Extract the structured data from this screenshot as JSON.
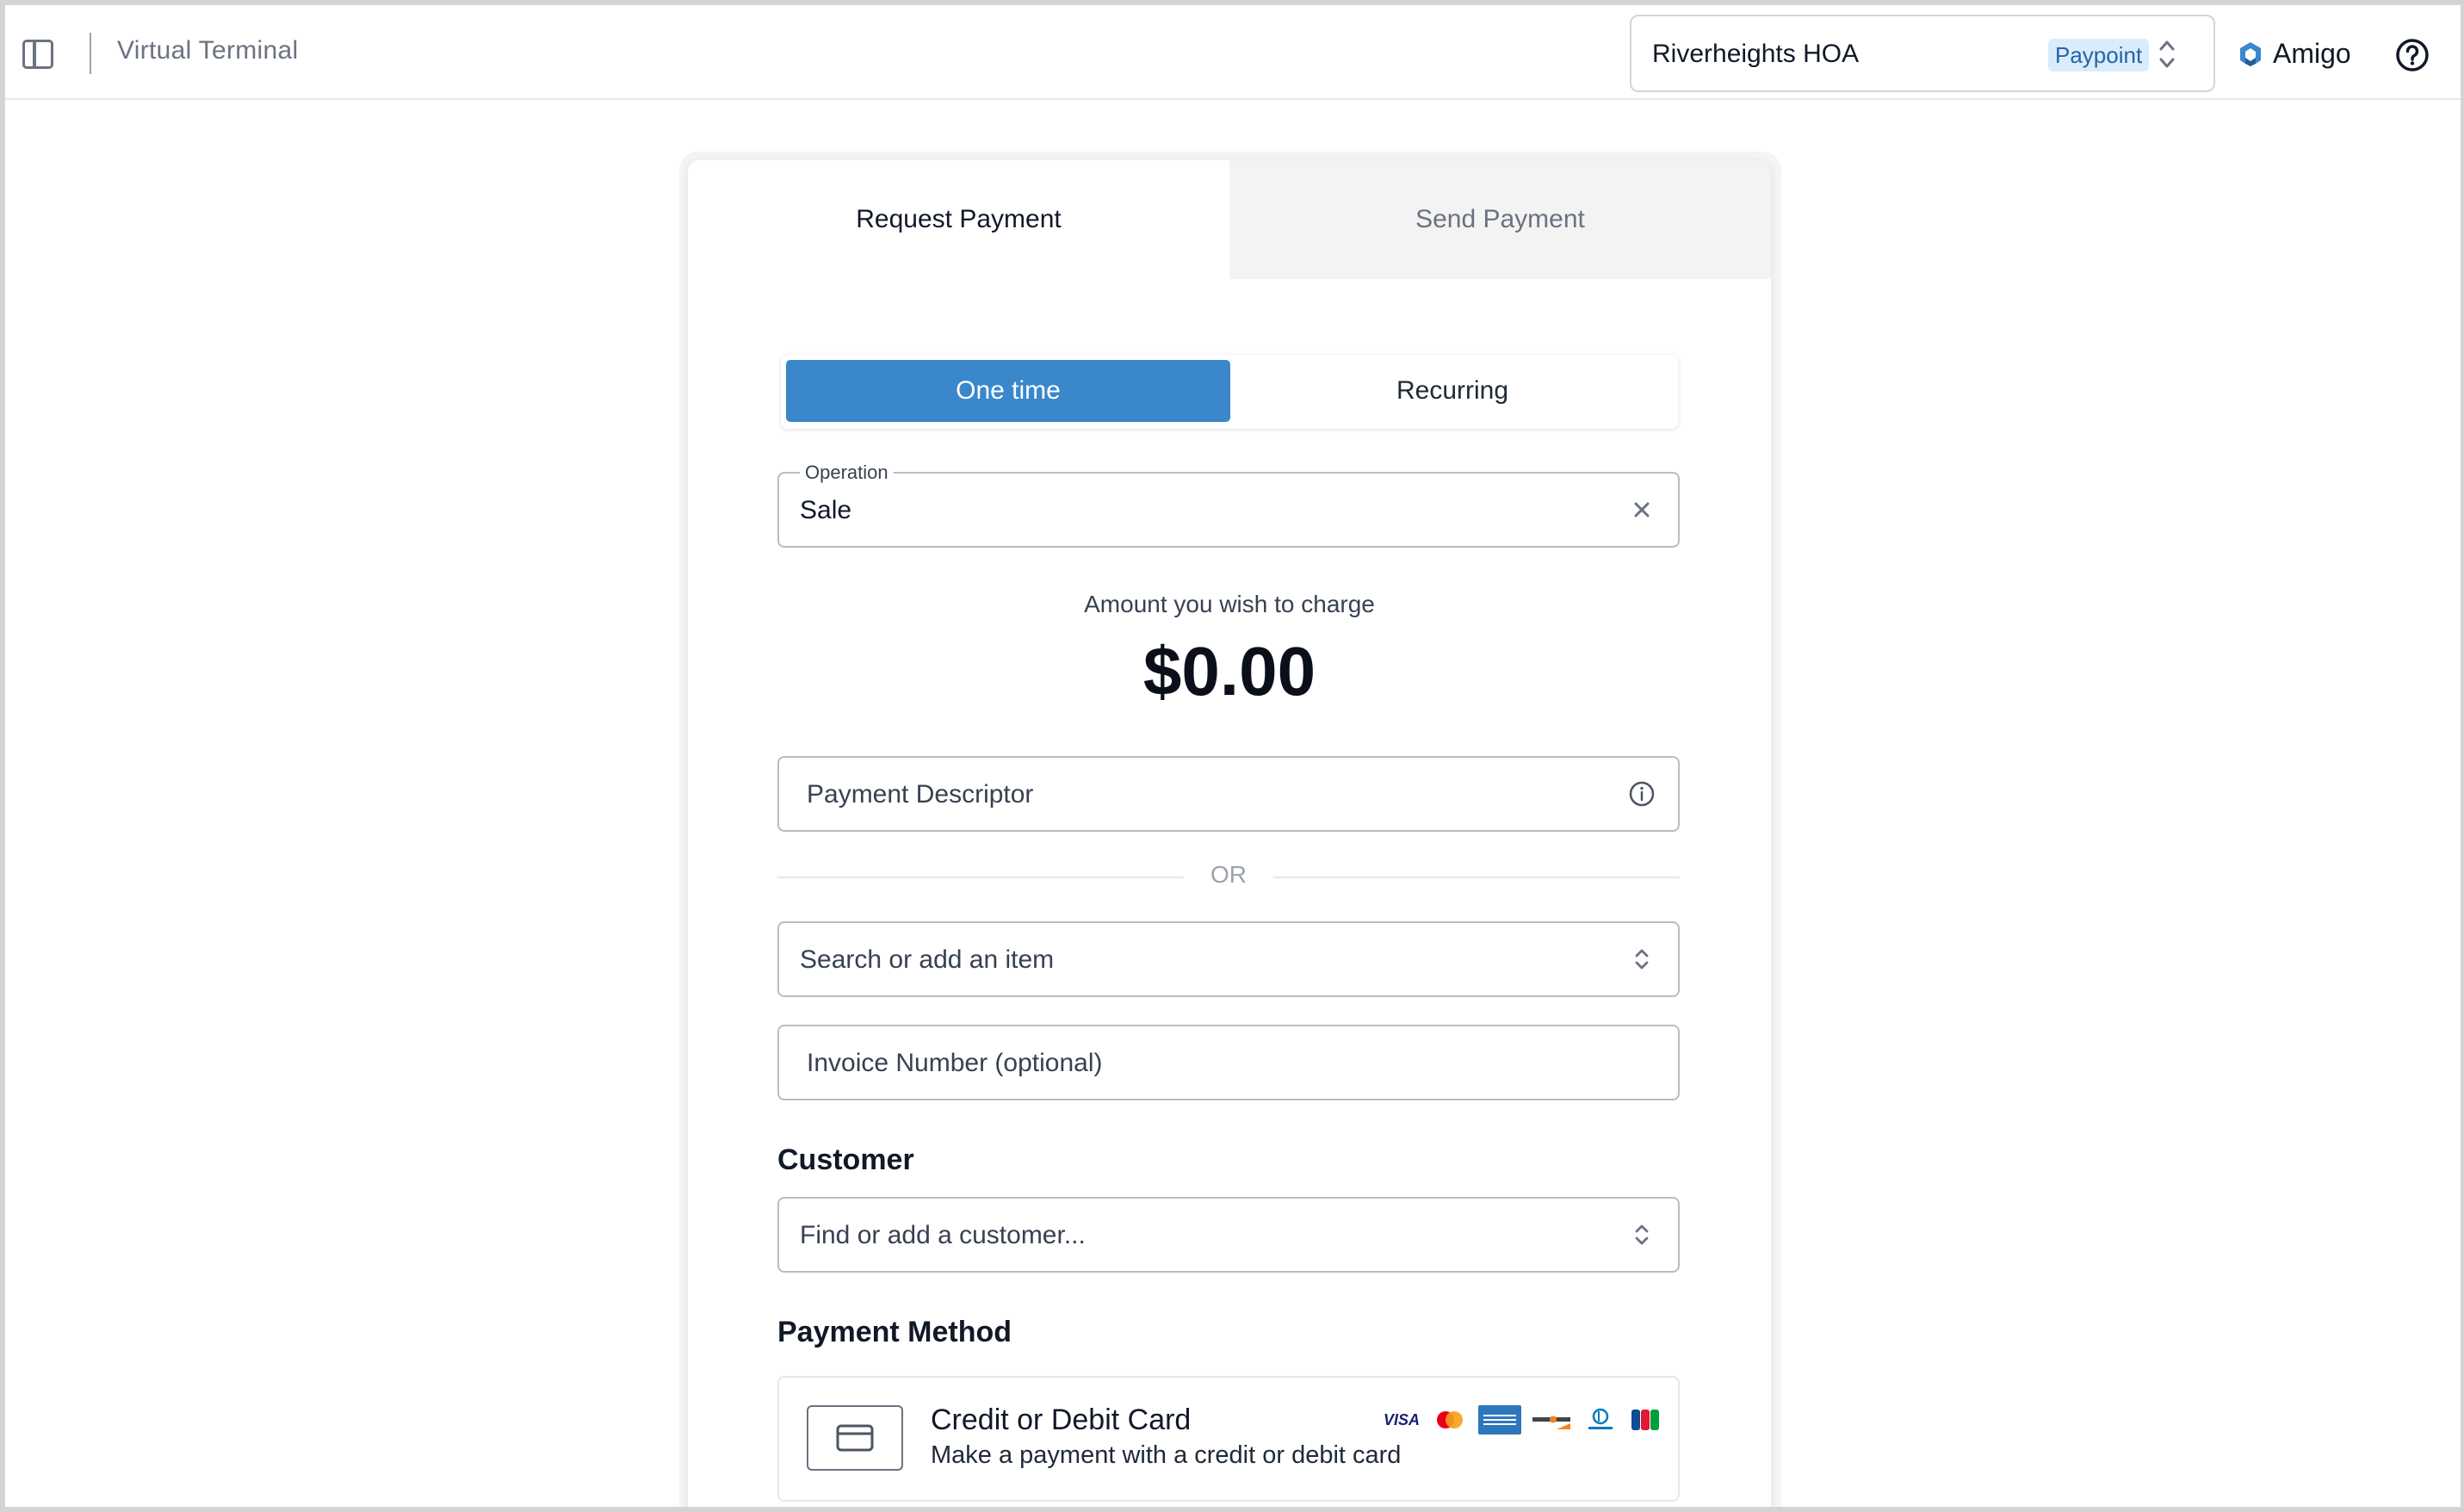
{
  "header": {
    "page_title": "Virtual Terminal",
    "org": {
      "name": "Riverheights HOA",
      "badge": "Paypoint"
    },
    "brand_name": "Amigo"
  },
  "tabs": [
    {
      "label": "Request Payment",
      "active": true
    },
    {
      "label": "Send Payment",
      "active": false
    }
  ],
  "frequency": {
    "options": [
      "One time",
      "Recurring"
    ],
    "selected": "One time"
  },
  "operation": {
    "label": "Operation",
    "value": "Sale"
  },
  "amount": {
    "label": "Amount you wish to charge",
    "value": "$0.00"
  },
  "payment_descriptor": {
    "placeholder": "Payment Descriptor"
  },
  "divider_text": "OR",
  "item_search": {
    "placeholder": "Search or add an item"
  },
  "invoice": {
    "placeholder": "Invoice Number (optional)"
  },
  "customer": {
    "title": "Customer",
    "placeholder": "Find or add a customer..."
  },
  "payment_method": {
    "title": "Payment Method",
    "card": {
      "title": "Credit or Debit Card",
      "subtitle": "Make a payment with a credit or debit card",
      "brands": [
        "VISA",
        "Mastercard",
        "American Express",
        "DISCOVER",
        "Diners Club",
        "JCB"
      ]
    }
  },
  "colors": {
    "accent": "#3a87cc",
    "badge_bg": "#d8ecfb",
    "badge_text": "#2563a8"
  }
}
